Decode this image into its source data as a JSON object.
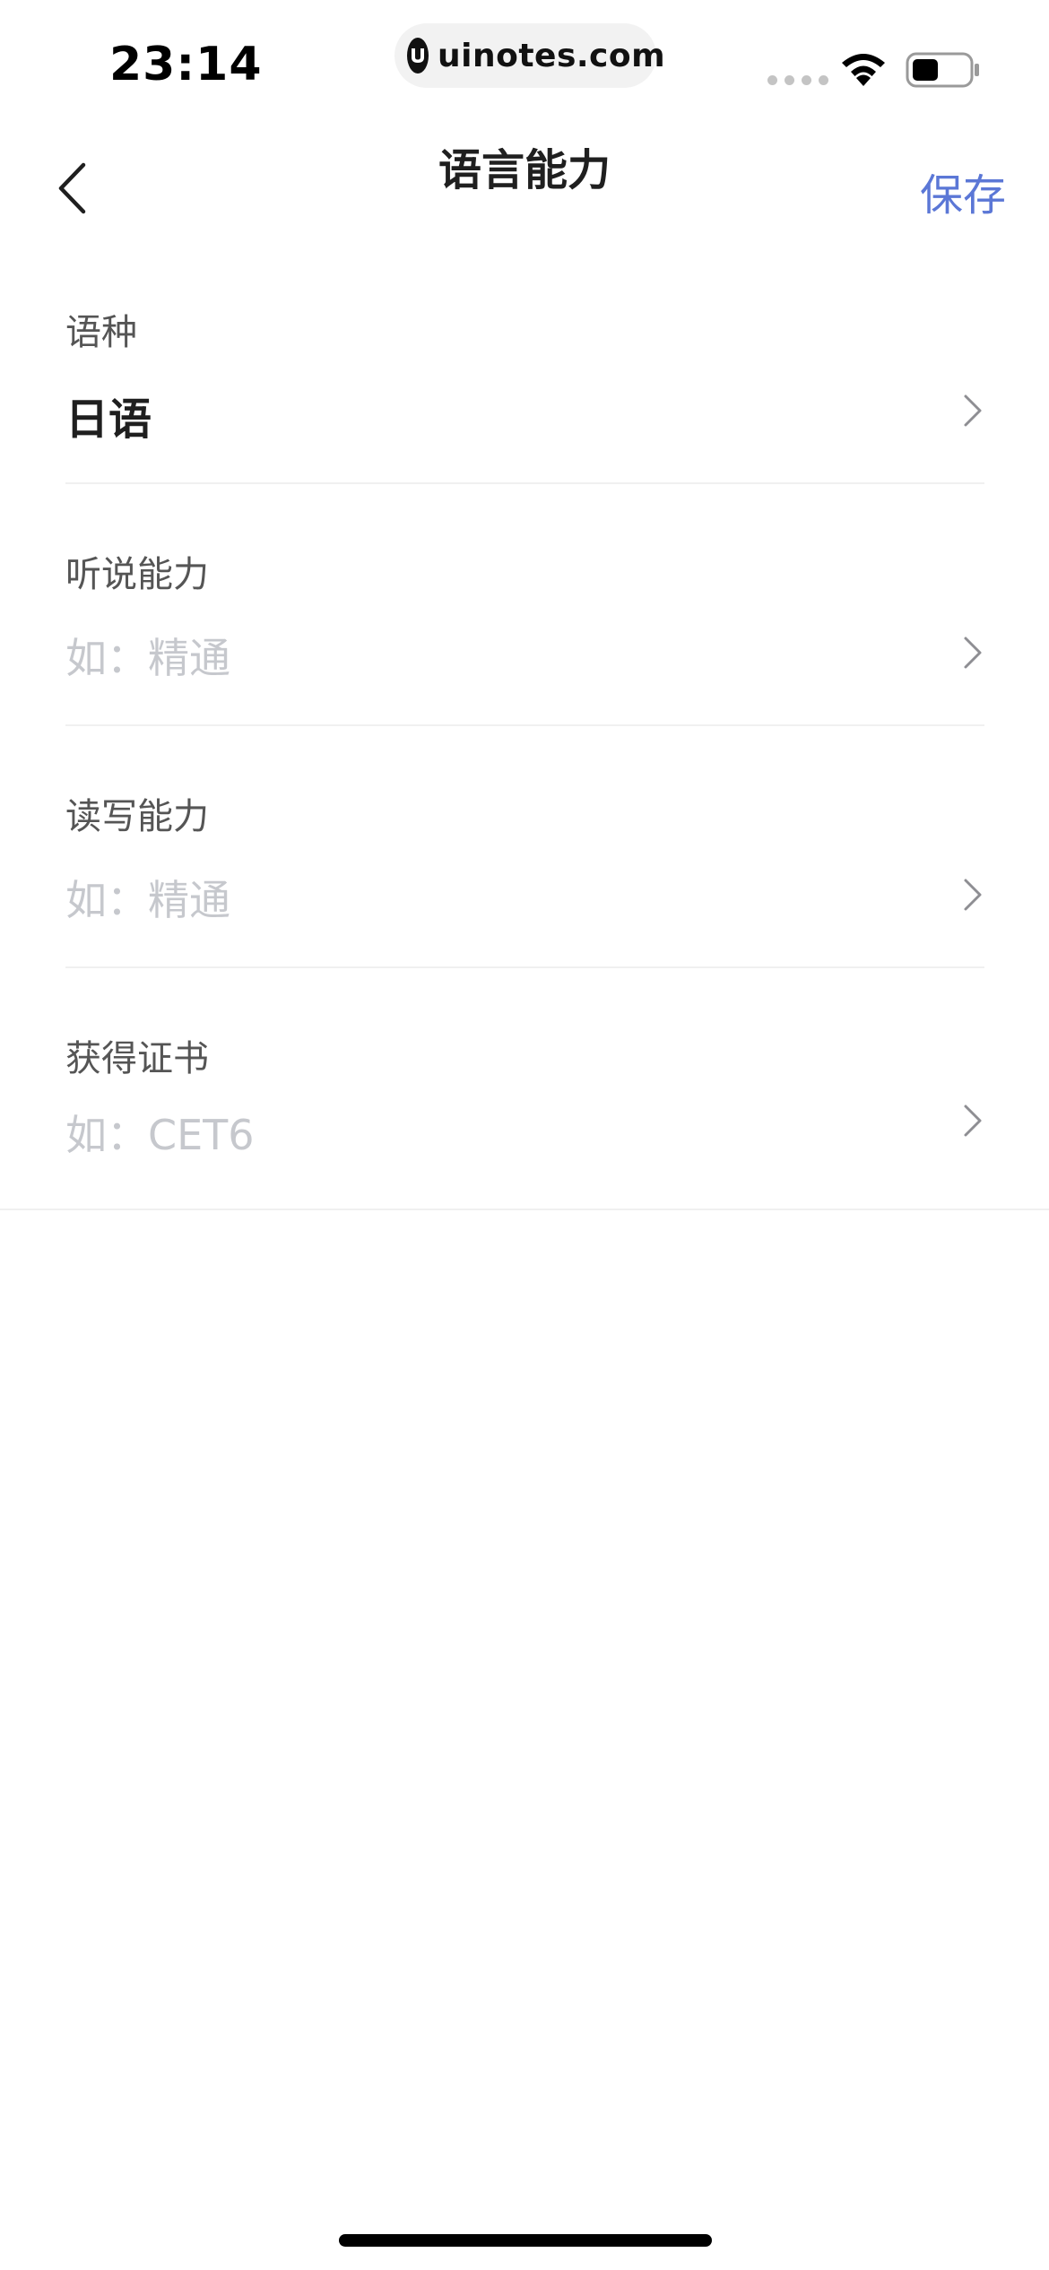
{
  "status_bar": {
    "time": "23:14",
    "url": "uinotes.com"
  },
  "nav": {
    "title": "语言能力",
    "save_label": "保存"
  },
  "form": {
    "rows": [
      {
        "label": "语种",
        "value": "日语",
        "placeholder": ""
      },
      {
        "label": "听说能力",
        "value": "",
        "placeholder": "如：精通"
      },
      {
        "label": "读写能力",
        "value": "",
        "placeholder": "如：精通"
      },
      {
        "label": "获得证书",
        "value": "",
        "placeholder": "如：CET6"
      }
    ]
  },
  "icons": {
    "back": "chevron-left-icon",
    "row_arrow": "chevron-right-icon",
    "wifi": "wifi-icon",
    "battery": "battery-icon",
    "signal": "signal-icon",
    "site_logo": "uinotes-logo-icon"
  },
  "colors": {
    "accent": "#5b77d6",
    "placeholder": "#c6c8cd",
    "label": "#555555",
    "divider": "#f0f0f0"
  }
}
